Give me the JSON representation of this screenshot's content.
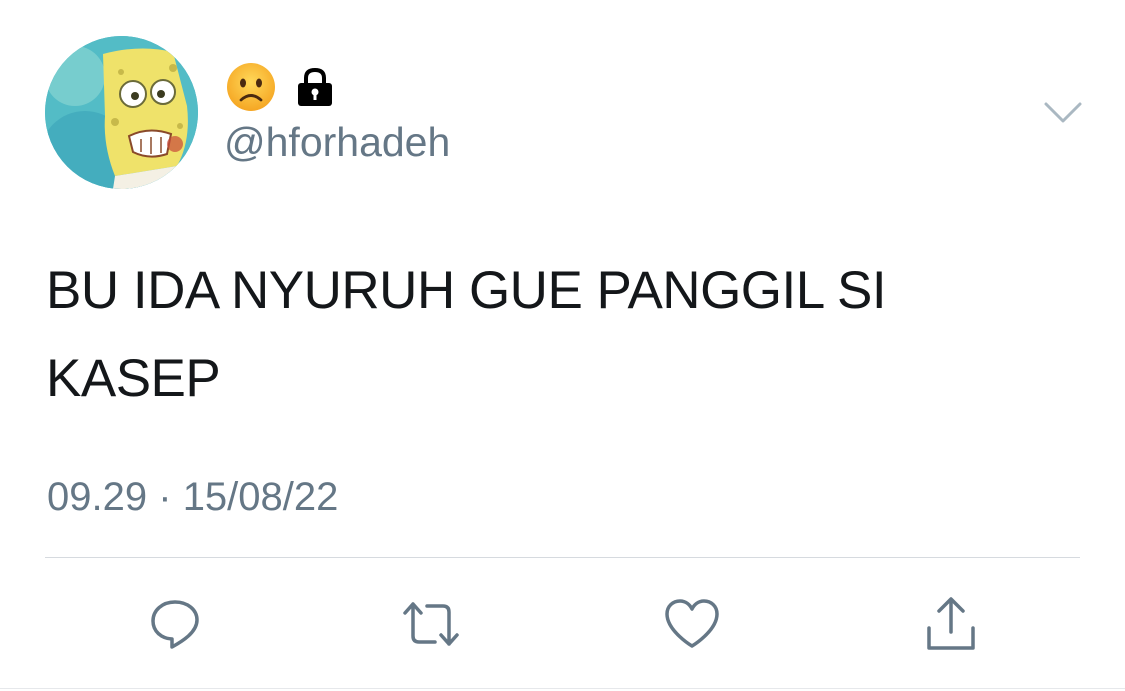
{
  "header": {
    "handle": "@hforhadeh",
    "name_icons": [
      "frown-face-emoji",
      "lock-icon"
    ],
    "menu_icon": "chevron-down-icon"
  },
  "tweet": {
    "text": "BU IDA NYURUH GUE PANGGIL SI KASEP",
    "time": "09.29",
    "separator": "·",
    "date": "15/08/22"
  },
  "actions": [
    {
      "icon": "reply-icon"
    },
    {
      "icon": "retweet-icon"
    },
    {
      "icon": "like-icon"
    },
    {
      "icon": "share-icon"
    }
  ],
  "colors": {
    "text_primary": "#14171a",
    "text_secondary": "#657786",
    "icon_gray": "#657786",
    "divider": "#d6dadf"
  }
}
